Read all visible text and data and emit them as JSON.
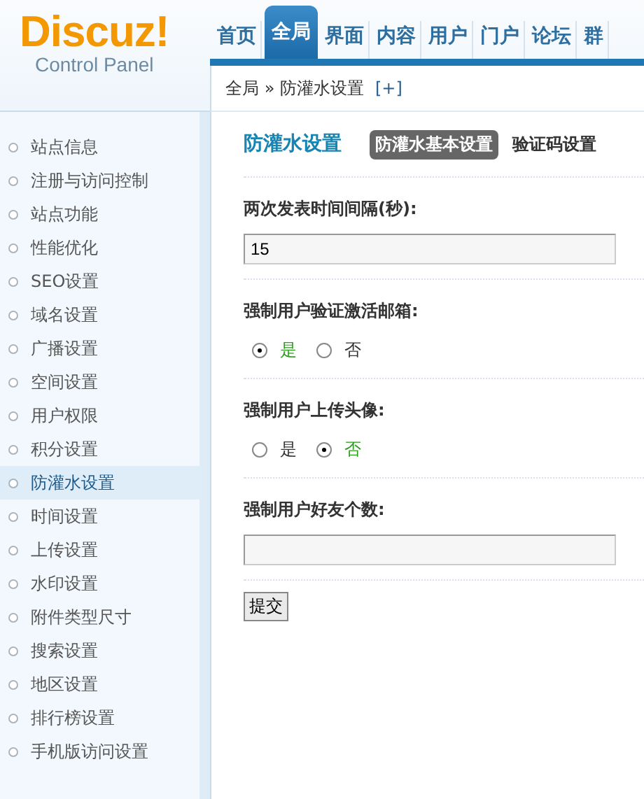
{
  "logo": {
    "title": "Discuz!",
    "subtitle": "Control Panel"
  },
  "nav": [
    {
      "label": "首页",
      "selected": false
    },
    {
      "label": "全局",
      "selected": true
    },
    {
      "label": "界面",
      "selected": false
    },
    {
      "label": "内容",
      "selected": false
    },
    {
      "label": "用户",
      "selected": false
    },
    {
      "label": "门户",
      "selected": false
    },
    {
      "label": "论坛",
      "selected": false
    },
    {
      "label": "群",
      "selected": false
    }
  ],
  "breadcrumb": {
    "path": "全局 » 防灌水设置",
    "add": "[+]"
  },
  "sidebar": {
    "items": [
      {
        "label": "站点信息",
        "selected": false
      },
      {
        "label": "注册与访问控制",
        "selected": false
      },
      {
        "label": "站点功能",
        "selected": false
      },
      {
        "label": "性能优化",
        "selected": false
      },
      {
        "label": "SEO设置",
        "selected": false
      },
      {
        "label": "域名设置",
        "selected": false
      },
      {
        "label": "广播设置",
        "selected": false
      },
      {
        "label": "空间设置",
        "selected": false
      },
      {
        "label": "用户权限",
        "selected": false
      },
      {
        "label": "积分设置",
        "selected": false
      },
      {
        "label": "防灌水设置",
        "selected": true
      },
      {
        "label": "时间设置",
        "selected": false
      },
      {
        "label": "上传设置",
        "selected": false
      },
      {
        "label": "水印设置",
        "selected": false
      },
      {
        "label": "附件类型尺寸",
        "selected": false
      },
      {
        "label": "搜索设置",
        "selected": false
      },
      {
        "label": "地区设置",
        "selected": false
      },
      {
        "label": "排行榜设置",
        "selected": false
      },
      {
        "label": "手机版访问设置",
        "selected": false
      }
    ]
  },
  "page": {
    "title": "防灌水设置",
    "tabs": [
      {
        "label": "防灌水基本设置",
        "selected": true
      },
      {
        "label": "验证码设置",
        "selected": false
      }
    ]
  },
  "fields": [
    {
      "kind": "text",
      "label": "两次发表时间间隔(秒):",
      "value": "15"
    },
    {
      "kind": "radio",
      "label": "强制用户验证激活邮箱:",
      "options": [
        {
          "label": "是",
          "selected": true
        },
        {
          "label": "否",
          "selected": false
        }
      ]
    },
    {
      "kind": "radio",
      "label": "强制用户上传头像:",
      "options": [
        {
          "label": "是",
          "selected": false
        },
        {
          "label": "否",
          "selected": true
        }
      ]
    },
    {
      "kind": "text",
      "label": "强制用户好友个数:"
    }
  ],
  "submit": "提交"
}
